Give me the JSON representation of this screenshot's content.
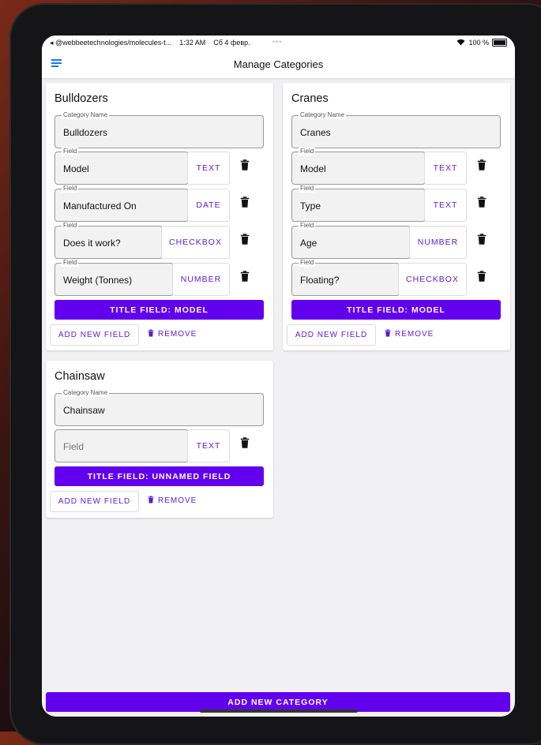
{
  "status": {
    "left": "◂ @webbeetechnologies/molecules-t...",
    "time": "1:32 AM",
    "date": "Сб 4 февр.",
    "mid": "•••",
    "battery": "100 %"
  },
  "appbar": {
    "title": "Manage Categories"
  },
  "labels": {
    "category_name": "Category Name",
    "field": "Field",
    "add_new_field": "ADD NEW FIELD",
    "remove": "REMOVE"
  },
  "cards": [
    {
      "title": "Bulldozers",
      "category_name": "Bulldozers",
      "fields": [
        {
          "value": "Model",
          "type": "TEXT"
        },
        {
          "value": "Manufactured On",
          "type": "DATE"
        },
        {
          "value": "Does it work?",
          "type": "CHECKBOX"
        },
        {
          "value": "Weight (Tonnes)",
          "type": "NUMBER"
        }
      ],
      "title_field": "TITLE FIELD: MODEL"
    },
    {
      "title": "Cranes",
      "category_name": "Cranes",
      "fields": [
        {
          "value": "Model",
          "type": "TEXT"
        },
        {
          "value": "Type",
          "type": "TEXT"
        },
        {
          "value": "Age",
          "type": "NUMBER"
        },
        {
          "value": "Floating?",
          "type": "CHECKBOX"
        }
      ],
      "title_field": "TITLE FIELD: MODEL"
    },
    {
      "title": "Chainsaw",
      "category_name": "Chainsaw",
      "fields": [
        {
          "value": "",
          "placeholder": "Field",
          "type": "TEXT"
        }
      ],
      "title_field": "TITLE FIELD: UNNAMED FIELD"
    }
  ],
  "bottom_button": "ADD NEW CATEGORY",
  "colors": {
    "primary": "#6200ee",
    "accent_text": "#5b1ad6",
    "menu_icon": "#1a73e8"
  }
}
